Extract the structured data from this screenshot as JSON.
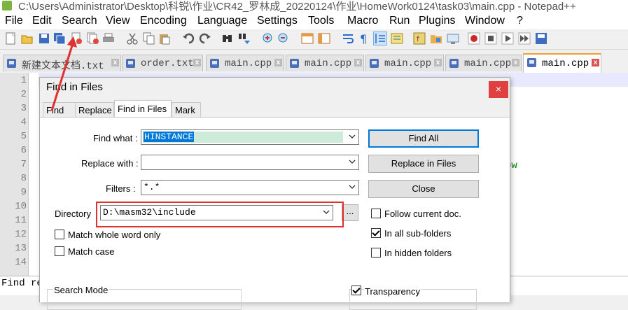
{
  "window": {
    "title": "C:\\Users\\Administrator\\Desktop\\科锐\\作业\\CR42_罗林成_20220124\\作业\\HomeWork0124\\task03\\main.cpp - Notepad++"
  },
  "menu": [
    "File",
    "Edit",
    "Search",
    "View",
    "Encoding",
    "Language",
    "Settings",
    "Tools",
    "Macro",
    "Run",
    "Plugins",
    "Window",
    "?"
  ],
  "toolbar_icons": [
    "new-file-icon",
    "open-icon",
    "save-icon",
    "save-all-icon",
    "close-icon",
    "close-all-icon",
    "print-icon",
    "cut-icon",
    "copy-icon",
    "paste-icon",
    "undo-icon",
    "redo-icon",
    "find-icon",
    "replace-icon",
    "zoom-in-icon",
    "zoom-out-icon",
    "sync-vertical-icon",
    "sync-horizontal-icon",
    "word-wrap-icon",
    "show-all-chars-icon",
    "indent-guide-icon",
    "doc-map-icon",
    "function-list-icon",
    "folder-workspace-icon",
    "monitor-icon",
    "record-macro-icon",
    "stop-record-icon",
    "play-macro-icon",
    "run-macro-multiple-icon",
    "save-macro-icon"
  ],
  "tabs": [
    {
      "label": "新建文本文档.txt",
      "active": false
    },
    {
      "label": "order.txt",
      "active": false
    },
    {
      "label": "main.cpp",
      "active": false
    },
    {
      "label": "main.cpp",
      "active": false
    },
    {
      "label": "main.cpp",
      "active": false
    },
    {
      "label": "main.cpp",
      "active": false
    },
    {
      "label": "main.cpp",
      "active": true
    }
  ],
  "editor": {
    "line_numbers": [
      "1",
      "2",
      "3",
      "4",
      "5",
      "6",
      "7",
      "8",
      "9",
      "10",
      "11",
      "12",
      "13",
      "14"
    ],
    "visible_code_fragment": "ow"
  },
  "status": {
    "text": "Find re"
  },
  "dialog": {
    "title": "Find in Files",
    "close_label": "×",
    "tabs": [
      "Find",
      "Replace",
      "Find in Files",
      "Mark"
    ],
    "active_tab": "Find in Files",
    "find_what": {
      "label": "Find what :",
      "value": "HINSTANCE"
    },
    "replace_with": {
      "label": "Replace with :",
      "value": ""
    },
    "filters": {
      "label": "Filters :",
      "value": "*.*"
    },
    "directory": {
      "label": "Directory",
      "value": "D:\\masm32\\include",
      "browse_label": "..."
    },
    "buttons": {
      "find_all": "Find All",
      "replace_in_files": "Replace in Files",
      "close": "Close"
    },
    "options": [
      {
        "label": "Match whole word only",
        "checked": false
      },
      {
        "label": "Match case",
        "checked": false
      },
      {
        "label": "Follow current doc.",
        "checked": false
      },
      {
        "label": "In all sub-folders",
        "checked": true
      },
      {
        "label": "In hidden folders",
        "checked": false
      },
      {
        "label": "Transparency",
        "checked": true
      }
    ],
    "search_mode_label": "Search Mode"
  },
  "colors": {
    "annotation_red": "#e03030",
    "accent_blue": "#0078d7"
  }
}
